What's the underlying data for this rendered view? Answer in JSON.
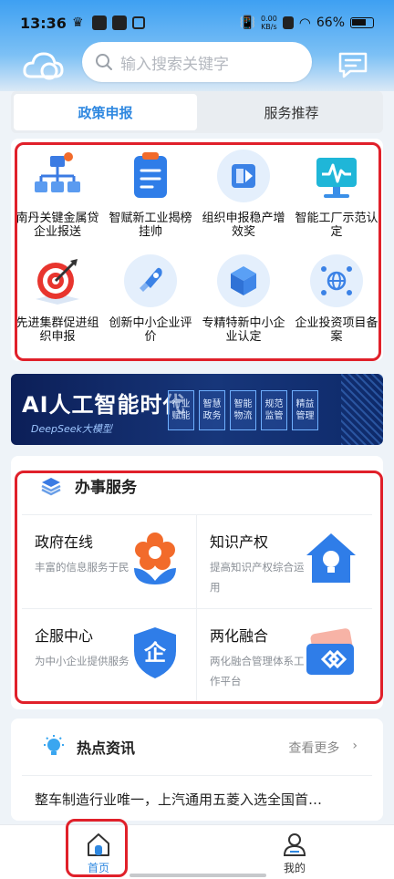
{
  "status_bar": {
    "time": "13:36",
    "net_speed_value": "0.00",
    "net_speed_unit": "KB/s",
    "battery": "66%"
  },
  "search": {
    "placeholder": "输入搜索关键字"
  },
  "tabs": [
    {
      "label": "政策申报",
      "active": true
    },
    {
      "label": "服务推荐",
      "active": false
    }
  ],
  "grid": {
    "items": [
      {
        "label": "南丹关键金属贷企业报送",
        "icon": "org-chart-icon"
      },
      {
        "label": "智赋新工业揭榜挂帅",
        "icon": "clipboard-list-icon"
      },
      {
        "label": "组织申报稳产增效奖",
        "icon": "media-panel-icon"
      },
      {
        "label": "智能工厂示范认定",
        "icon": "monitor-pulse-icon"
      },
      {
        "label": "先进集群促进组织申报",
        "icon": "target-icon"
      },
      {
        "label": "创新中小企业评价",
        "icon": "rocket-icon"
      },
      {
        "label": "专精特新中小企业认定",
        "icon": "cube-icon"
      },
      {
        "label": "企业投资项目备案",
        "icon": "globe-network-icon"
      }
    ]
  },
  "banner": {
    "title": "AI人工智能时代",
    "subtitle": "DeepSeek大模型",
    "tags": [
      "行业赋能",
      "智慧政务",
      "智能物流",
      "规范监管",
      "精益管理"
    ]
  },
  "services": {
    "title": "办事服务",
    "items": [
      {
        "title": "政府在线",
        "desc": "丰富的信息服务于民",
        "icon": "flower-icon"
      },
      {
        "title": "知识产权",
        "desc": "提高知识产权综合运用",
        "icon": "house-bulb-icon"
      },
      {
        "title": "企服中心",
        "desc": "为中小企业提供服务",
        "icon": "shield-qi-icon"
      },
      {
        "title": "两化融合",
        "desc": "两化融合管理体系工作平台",
        "icon": "card-diamond-icon"
      }
    ]
  },
  "news": {
    "title": "热点资讯",
    "more": "查看更多",
    "headline": "整车制造行业唯一，上汽通用五菱入选全国首…"
  },
  "bottom_nav": [
    {
      "label": "首页",
      "active": true
    },
    {
      "label": "我的",
      "active": false
    }
  ],
  "colors": {
    "accent": "#2f88e0",
    "highlight_box": "#e0202a"
  }
}
